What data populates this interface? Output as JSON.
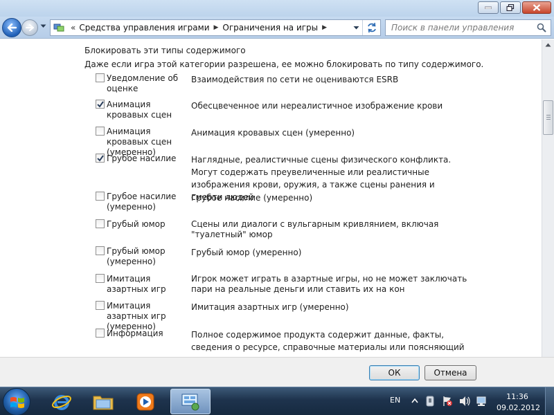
{
  "navbar": {
    "breadcrumb_prefix": "«",
    "breadcrumbs": [
      "Средства управления играми",
      "Ограничения на игры"
    ],
    "search_placeholder": "Поиск в панели управления"
  },
  "content": {
    "heading": "Блокировать эти типы содержимого",
    "subheading": "Даже если игра этой категории разрешена, ее можно блокировать по типу содержимого.",
    "items": [
      {
        "label": "Уведомление об оценке",
        "description": "Взаимодействия по сети не оцениваются ESRB",
        "checked": false
      },
      {
        "label": "Анимация кровавых сцен",
        "description": "Обесцвеченное или нереалистичное изображение крови",
        "checked": true
      },
      {
        "label": "Анимация кровавых сцен (умеренно)",
        "description": "Анимация кровавых сцен (умеренно)",
        "checked": false
      },
      {
        "label": "Грубое насилие",
        "description": "Наглядные, реалистичные сцены физического конфликта. Могут содержать преувеличенные или реалистичные изображения крови, оружия, а также сцены ранения и смерти людей",
        "checked": true
      },
      {
        "label": "Грубое насилие (умеренно)",
        "description": "Грубое насилие (умеренно)",
        "checked": false
      },
      {
        "label": "Грубый юмор",
        "description": "Сцены или диалоги с вульгарным кривлянием, включая \"туалетный\" юмор",
        "checked": false
      },
      {
        "label": "Грубый юмор (умеренно)",
        "description": "Грубый юмор (умеренно)",
        "checked": false
      },
      {
        "label": "Имитация азартных игр",
        "description": "Игрок может играть в азартные игры, но не может заключать пари на реальные деньги или ставить их на кон",
        "checked": false
      },
      {
        "label": "Имитация азартных игр (умеренно)",
        "description": "Имитация азартных игр (умеренно)",
        "checked": false
      },
      {
        "label": "Информация",
        "description": "Полное содержимое продукта содержит данные, факты, сведения о ресурсе, справочные материалы или поясняющий текст",
        "checked": false
      }
    ]
  },
  "buttons": {
    "ok": "ОК",
    "cancel": "Отмена"
  },
  "taskbar": {
    "language": "EN",
    "time": "11:36",
    "date": "09.02.2012"
  },
  "colors": {
    "title_bar": "#c4d9f0",
    "taskbar": "#1e334d",
    "close_button": "#c7452b"
  }
}
